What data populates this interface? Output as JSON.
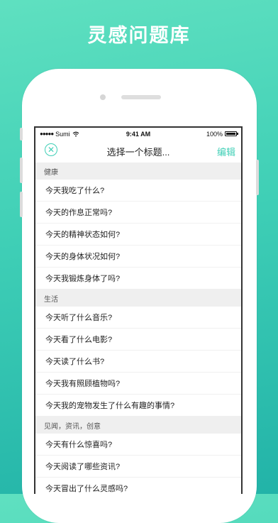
{
  "promo": {
    "title": "灵感问题库"
  },
  "status_bar": {
    "carrier": "Sumi",
    "signal": "●●●●●",
    "time": "9:41 AM",
    "battery": "100%"
  },
  "nav": {
    "title": "选择一个标题...",
    "edit_label": "编辑",
    "close_icon": "close-icon"
  },
  "sections": [
    {
      "header": "健康",
      "items": [
        "今天我吃了什么?",
        "今天的作息正常吗?",
        "今天的精神状态如何?",
        "今天的身体状况如何?",
        "今天我锻炼身体了吗?"
      ]
    },
    {
      "header": "生活",
      "items": [
        "今天听了什么音乐?",
        "今天看了什么电影?",
        "今天读了什么书?",
        "今天我有照顾植物吗?",
        "今天我的宠物发生了什么有趣的事情?"
      ]
    },
    {
      "header": "见闻，资讯，创意",
      "items": [
        "今天有什么惊喜吗?",
        "今天阅读了哪些资讯?",
        "今天冒出了什么灵感吗?"
      ]
    }
  ],
  "colors": {
    "accent": "#3fcfb6",
    "background_top": "#5fe0c0",
    "background_bottom": "#22b3a8"
  }
}
